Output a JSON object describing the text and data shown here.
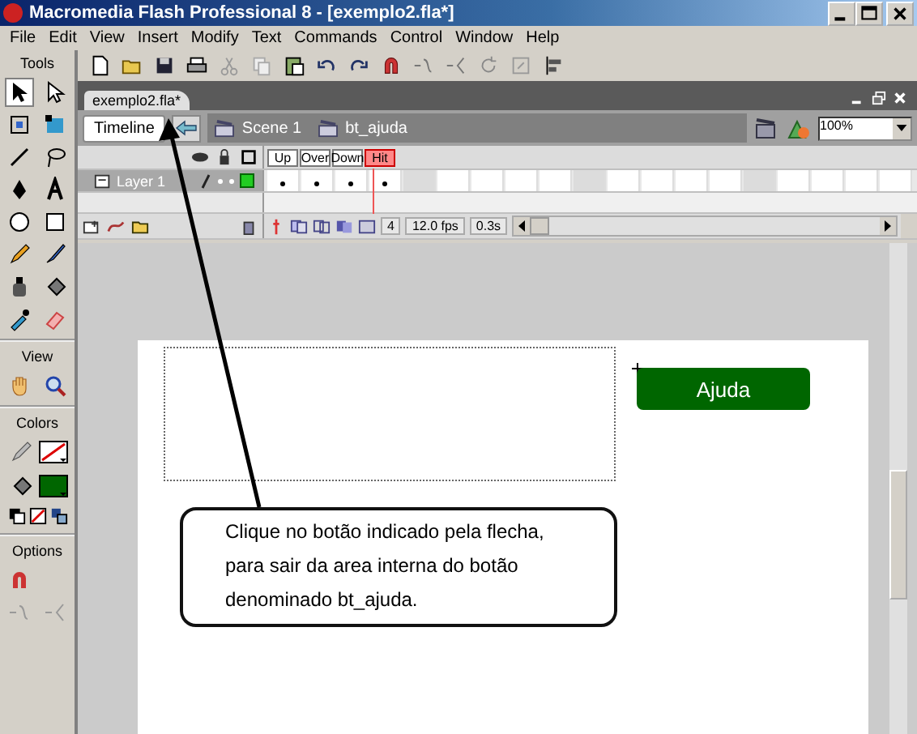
{
  "window": {
    "title": "Macromedia Flash Professional 8 - [exemplo2.fla*]"
  },
  "menu": [
    "File",
    "Edit",
    "View",
    "Insert",
    "Modify",
    "Text",
    "Commands",
    "Control",
    "Window",
    "Help"
  ],
  "tools_panel": {
    "title": "Tools",
    "sections": [
      "View",
      "Colors",
      "Options"
    ]
  },
  "document_tab": {
    "label": "exemplo2.fla*",
    "selected": true
  },
  "edit_bar": {
    "timeline_button": "Timeline",
    "breadcrumbs": [
      "Scene 1",
      "bt_ajuda"
    ],
    "zoom": "100%"
  },
  "timeline": {
    "frames": [
      {
        "label": "Up",
        "keyframe": true,
        "selected": false
      },
      {
        "label": "Over",
        "keyframe": true,
        "selected": false
      },
      {
        "label": "Down",
        "keyframe": true,
        "selected": false
      },
      {
        "label": "Hit",
        "keyframe": true,
        "selected": true
      }
    ],
    "layers": [
      {
        "name": "Layer 1",
        "selected": true
      }
    ],
    "current_frame": "4",
    "frame_rate": "12.0 fps",
    "elapsed": "0.3s"
  },
  "stage": {
    "button_label": "Ajuda",
    "callout": "Clique no botão indicado pela flecha,\npara sair da area  interna do botão\ndenominado bt_ajuda."
  }
}
